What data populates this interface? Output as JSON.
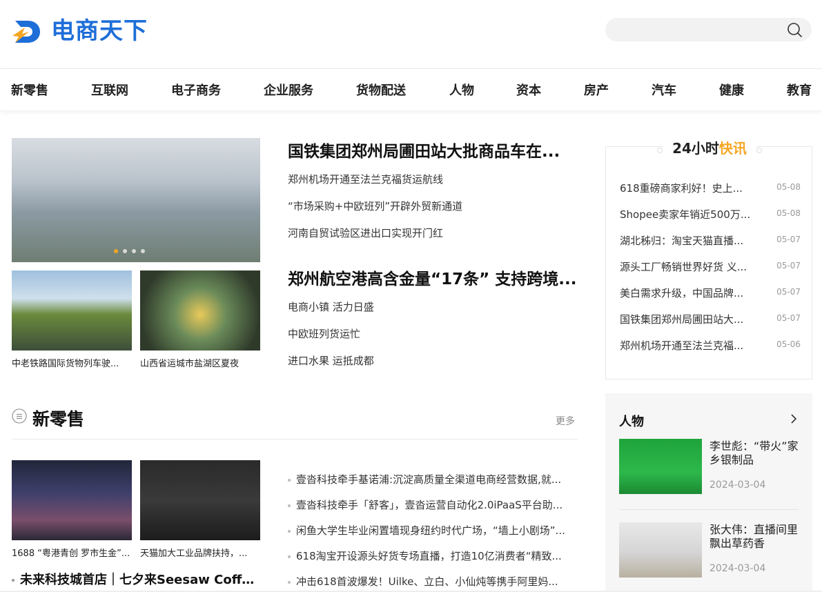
{
  "brand": {
    "name": "电商天下",
    "color": "#1e6ed8"
  },
  "search": {
    "placeholder": ""
  },
  "nav": [
    "新零售",
    "互联网",
    "电子商务",
    "企业服务",
    "货物配送",
    "人物",
    "资本",
    "房产",
    "汽车",
    "健康",
    "教育"
  ],
  "featured": {
    "small_captions": [
      "中老铁路国际货物列车驶...",
      "山西省运城市盐湖区夏夜"
    ],
    "headline1": "国铁集团郑州局圃田站大批商品车在...",
    "subs1": [
      "郑州机场开通至法兰克福货运航线",
      "“市场采购+中欧班列”开辟外贸新通道",
      "河南自贸试验区进出口实现开门红"
    ],
    "headline2": "郑州航空港高含金量“17条” 支持跨境...",
    "subs2": [
      "电商小镇 活力日盛",
      "中欧班列货运忙",
      "进口水果 运抵成都"
    ]
  },
  "flash": {
    "title_a": "24小时",
    "title_b": "快讯",
    "accent": "#f5a623",
    "items": [
      {
        "text": "618重磅商家利好！史上...",
        "date": "05-08"
      },
      {
        "text": "Shopee卖家年销近500万...",
        "date": "05-08"
      },
      {
        "text": "湖北秭归：淘宝天猫直播...",
        "date": "05-07"
      },
      {
        "text": "源头工厂畅销世界好货 义...",
        "date": "05-07"
      },
      {
        "text": "美白需求升级，中国品牌...",
        "date": "05-07"
      },
      {
        "text": "国铁集团郑州局圃田站大...",
        "date": "05-07"
      },
      {
        "text": "郑州机场开通至法兰克福...",
        "date": "05-06"
      }
    ]
  },
  "section": {
    "title": "新零售",
    "more": "更多",
    "image_captions": [
      "1688 “粤港青创 罗市生金”...",
      "天猫加大工业品牌扶持，..."
    ],
    "bullets": [
      "壹沓科技牵手基诺浦:沉淀高质量全渠道电商经营数据,就...",
      "壹沓科技牵手「舒客」，壹沓运营自动化2.0iPaaS平台助...",
      "闲鱼大学生毕业闲置墙现身纽约时代广场，“墙上小剧场”...",
      "618淘宝开设源头好货专场直播，打造10亿消费者“精致...",
      "冲击618首波爆发！Uilke、立白、小仙炖等携手阿里妈..."
    ],
    "bottom_title": "未来科技城首店｜七夕来Seesaw Coffee..."
  },
  "people": {
    "title": "人物",
    "items": [
      {
        "name": "李世彪：“带火”家乡银制品",
        "date": "2024-03-04"
      },
      {
        "name": "张大伟：直播间里飘出草药香",
        "date": "2024-03-04"
      }
    ]
  }
}
